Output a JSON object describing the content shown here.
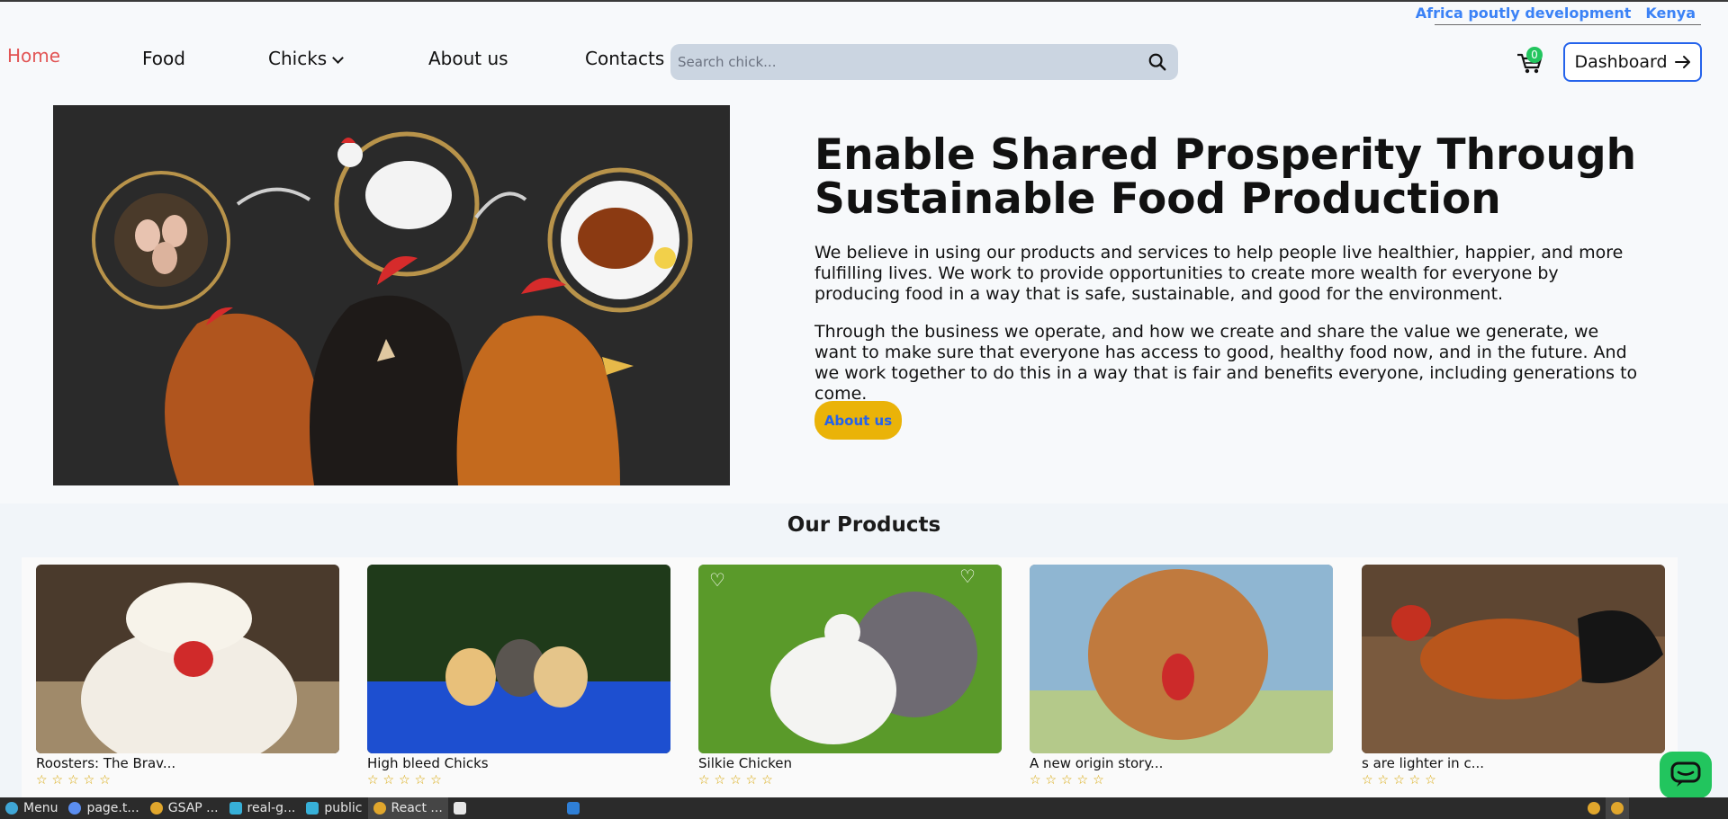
{
  "top_strip": {
    "company": "Africa poutly development",
    "country": "Kenya"
  },
  "nav": {
    "home": "Home",
    "food": "Food",
    "chicks": "Chicks",
    "about": "About us",
    "contacts": "Contacts",
    "search_placeholder": "Search chick...",
    "cart_count": "0",
    "dashboard": "Dashboard"
  },
  "hero": {
    "title": "Enable Shared Prosperity Through Sustainable Food Production",
    "p1": "We believe in using our products and services to help people live healthier, happier, and more fulfilling lives. We work to provide opportunities to create more wealth for everyone by producing food in a way that is safe, sustainable, and good for the environment.",
    "p2": "Through the business we operate, and how we create and share the value we generate, we want to make sure that everyone has access to good, healthy food now, and in the future. And we work together to do this in a way that is fair and benefits everyone, including generations to come.",
    "cta": "About us"
  },
  "products": {
    "title": "Our Products",
    "items": [
      {
        "name": "Roosters: The Brav...",
        "stars": "☆☆☆☆☆"
      },
      {
        "name": "High bleed Chicks",
        "stars": "☆☆☆☆☆"
      },
      {
        "name": "Silkie Chicken",
        "stars": "☆☆☆☆☆"
      },
      {
        "name": "A new origin story...",
        "stars": "☆☆☆☆☆"
      },
      {
        "name": "s are lighter in c...",
        "stars": "☆☆☆☆☆"
      }
    ]
  },
  "taskbar": {
    "menu": "Menu",
    "items": [
      "page.t...",
      "GSAP ...",
      "real-g...",
      "public",
      "React ..."
    ]
  },
  "colors": {
    "accent": "#2563eb",
    "home": "#e25555",
    "cta": "#eab308",
    "badge": "#22c55e"
  }
}
